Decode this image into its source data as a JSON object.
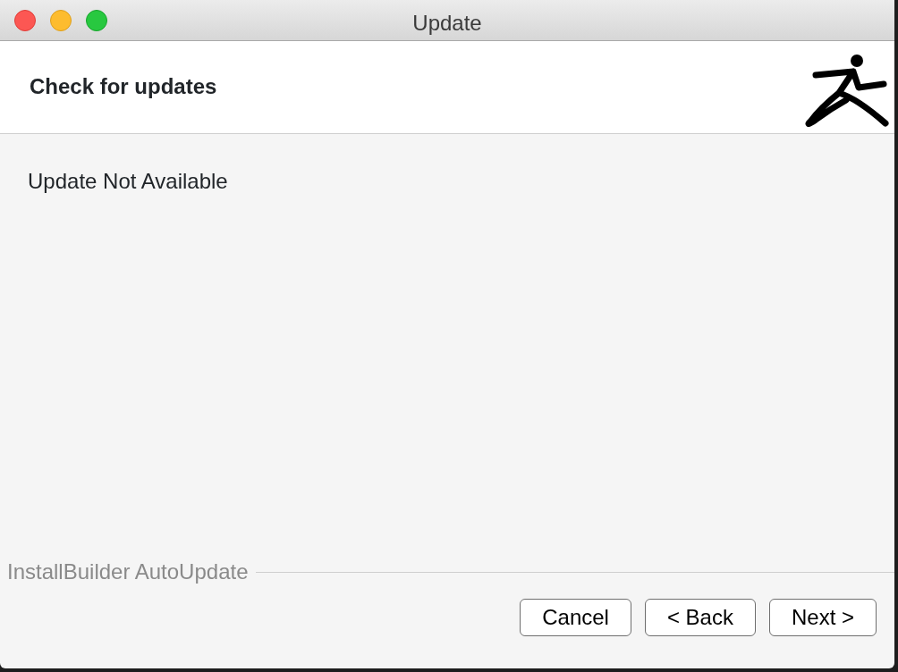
{
  "window": {
    "title": "Update"
  },
  "header": {
    "title": "Check for updates"
  },
  "message": "Update Not Available",
  "footer": {
    "brand": "InstallBuilder AutoUpdate"
  },
  "buttons": [
    {
      "label": "Cancel"
    },
    {
      "label": "< Back"
    },
    {
      "label": "Next >"
    }
  ]
}
